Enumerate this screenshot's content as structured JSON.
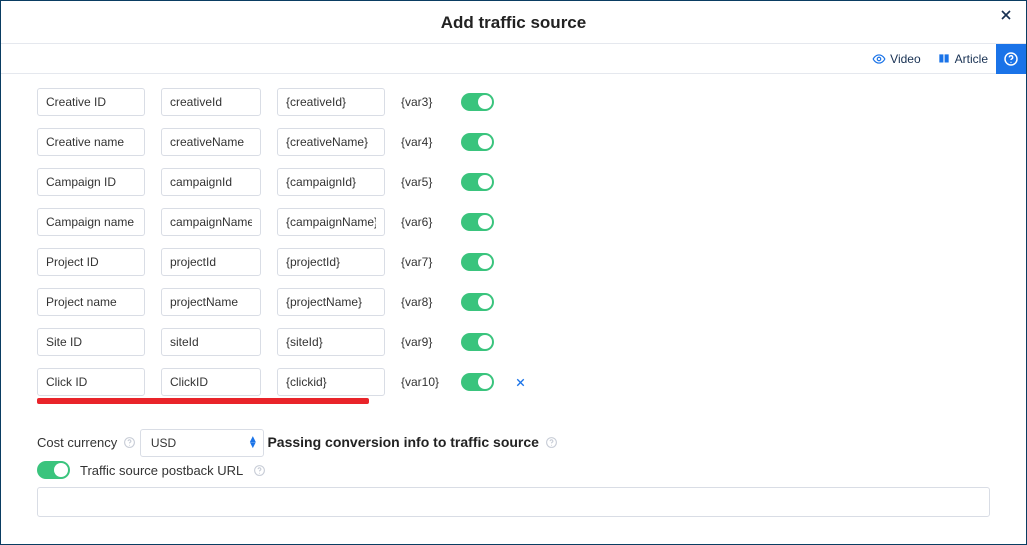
{
  "header": {
    "title": "Add traffic source"
  },
  "toolbar": {
    "video": "Video",
    "article": "Article"
  },
  "rows": [
    {
      "name": "Creative ID",
      "param": "creativeId",
      "token": "{creativeId}",
      "var": "{var3}"
    },
    {
      "name": "Creative name",
      "param": "creativeName",
      "token": "{creativeName}",
      "var": "{var4}"
    },
    {
      "name": "Campaign ID",
      "param": "campaignId",
      "token": "{campaignId}",
      "var": "{var5}"
    },
    {
      "name": "Campaign name",
      "param": "campaignName",
      "token": "{campaignName}",
      "var": "{var6}"
    },
    {
      "name": "Project ID",
      "param": "projectId",
      "token": "{projectId}",
      "var": "{var7}"
    },
    {
      "name": "Project name",
      "param": "projectName",
      "token": "{projectName}",
      "var": "{var8}"
    },
    {
      "name": "Site ID",
      "param": "siteId",
      "token": "{siteId}",
      "var": "{var9}"
    },
    {
      "name": "Click ID",
      "param": "ClickID",
      "token": "{clickid}",
      "var": "{var10}",
      "removable": true
    }
  ],
  "cost": {
    "label": "Cost currency",
    "value": "USD"
  },
  "passing": {
    "title": "Passing conversion info to traffic source",
    "postback_label": "Traffic source postback URL"
  }
}
